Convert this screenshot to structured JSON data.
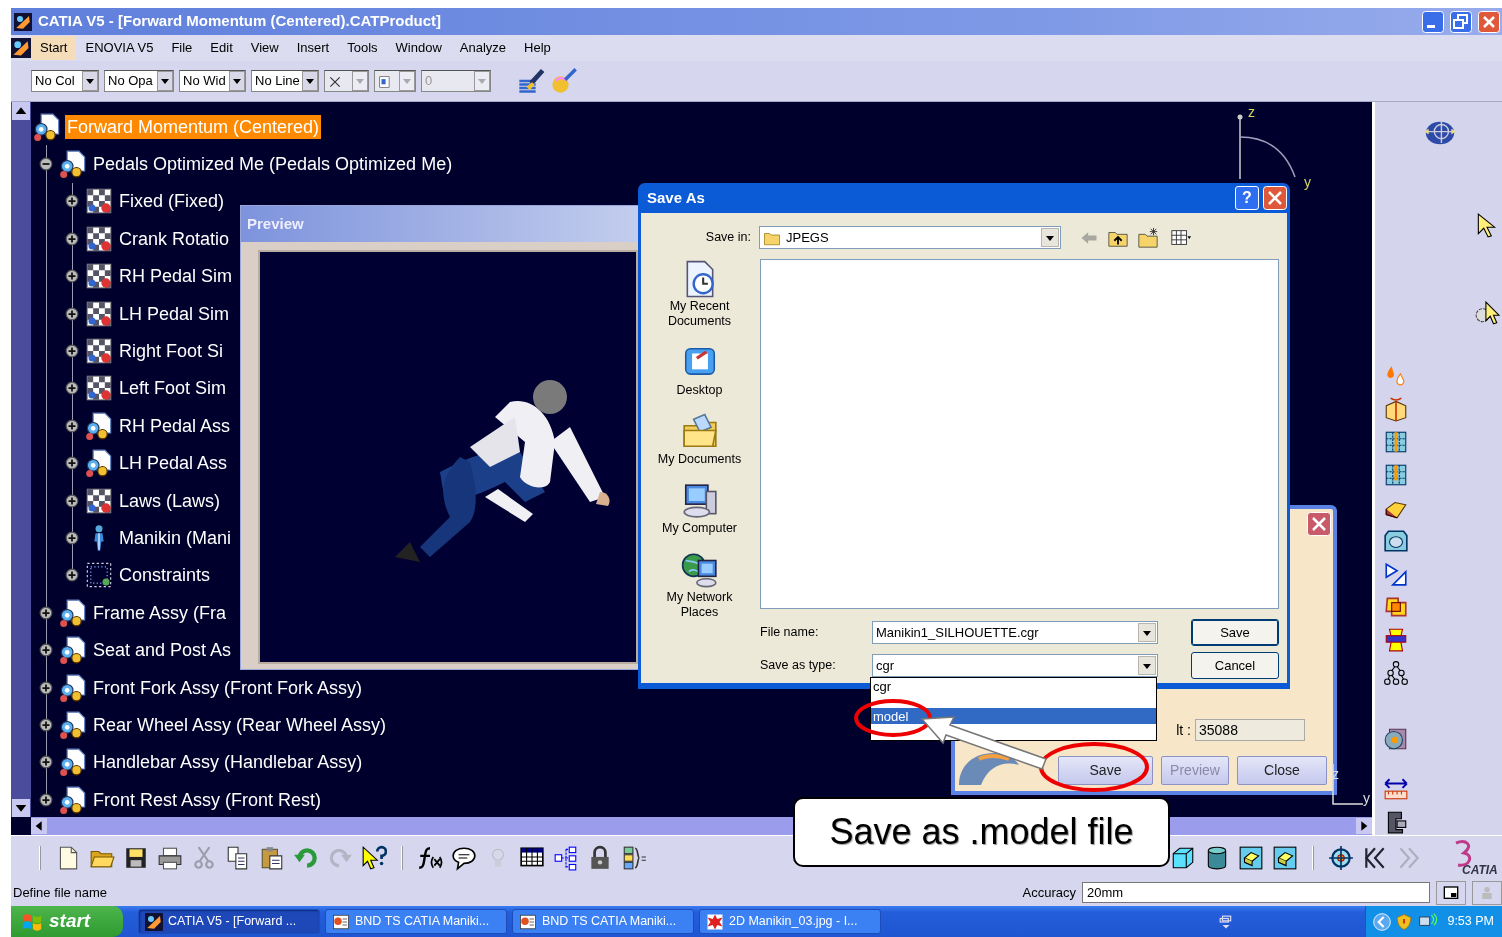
{
  "window": {
    "title": "CATIA V5 - [Forward Momentum (Centered).CATProduct]"
  },
  "menu": [
    {
      "label": "Start",
      "selected": true
    },
    {
      "label": "ENOVIA V5",
      "selected": false
    },
    {
      "label": "File",
      "selected": false
    },
    {
      "label": "Edit",
      "selected": false
    },
    {
      "label": "View",
      "selected": false
    },
    {
      "label": "Insert",
      "selected": false
    },
    {
      "label": "Tools",
      "selected": false
    },
    {
      "label": "Window",
      "selected": false
    },
    {
      "label": "Analyze",
      "selected": false
    },
    {
      "label": "Help",
      "selected": false
    }
  ],
  "graphic_toolbar": [
    {
      "kind": "text",
      "value": "No Col",
      "disabled": false
    },
    {
      "kind": "text",
      "value": "No Opa",
      "disabled": false
    },
    {
      "kind": "text",
      "value": "No Wid",
      "disabled": false
    },
    {
      "kind": "text",
      "value": "No Line",
      "disabled": false
    },
    {
      "kind": "linetype",
      "disabled": true
    },
    {
      "kind": "layer",
      "disabled": true
    },
    {
      "kind": "text",
      "value": "0",
      "disabled": true
    }
  ],
  "tree": {
    "label": "Forward Momentum (Centered)",
    "kind": "product",
    "selected": true,
    "children": [
      {
        "label": "Pedals Optimized Me (Pedals Optimized Me)",
        "kind": "product",
        "selected": false,
        "expanded": true,
        "children": [
          {
            "label": "Fixed (Fixed)",
            "kind": "mechanism",
            "selected": false,
            "expanded": false
          },
          {
            "label": "Crank Rotatio",
            "kind": "mechanism",
            "selected": false,
            "expanded": false
          },
          {
            "label": "RH Pedal Sim",
            "kind": "mechanism",
            "selected": false,
            "expanded": false
          },
          {
            "label": "LH Pedal Sim",
            "kind": "mechanism",
            "selected": false,
            "expanded": false
          },
          {
            "label": "Right Foot Si",
            "kind": "mechanism",
            "selected": false,
            "expanded": false
          },
          {
            "label": "Left Foot Sim",
            "kind": "mechanism",
            "selected": false,
            "expanded": false
          },
          {
            "label": "RH Pedal Ass",
            "kind": "product",
            "selected": false,
            "expanded": false
          },
          {
            "label": "LH Pedal Ass",
            "kind": "product",
            "selected": false,
            "expanded": false
          },
          {
            "label": "Laws (Laws)",
            "kind": "mechanism",
            "selected": false,
            "expanded": false
          },
          {
            "label": "Manikin (Mani",
            "kind": "manikin",
            "selected": false,
            "expanded": false
          },
          {
            "label": "Constraints",
            "kind": "constraints",
            "selected": false,
            "expanded": false
          }
        ]
      },
      {
        "label": "Frame Assy (Fra",
        "kind": "product",
        "selected": false,
        "expanded": false
      },
      {
        "label": "Seat and Post As",
        "kind": "product",
        "selected": false,
        "expanded": false
      },
      {
        "label": "Front Fork Assy (Front Fork Assy)",
        "kind": "product",
        "selected": false,
        "expanded": false
      },
      {
        "label": "Rear Wheel Assy (Rear Wheel Assy)",
        "kind": "product",
        "selected": false,
        "expanded": false
      },
      {
        "label": "Handlebar Assy (Handlebar Assy)",
        "kind": "product",
        "selected": false,
        "expanded": false
      },
      {
        "label": "Front Rest Assy (Front Rest)",
        "kind": "product",
        "selected": false,
        "expanded": false
      }
    ]
  },
  "preview_window": {
    "title": "Preview"
  },
  "compass": {
    "z_label": "z",
    "y_label": "y"
  },
  "axis": {
    "z_label": "z",
    "y_label": "y"
  },
  "save_as_dialog": {
    "title": "Save As",
    "help_button": "?",
    "save_in_label": "Save in:",
    "save_in_value": "JPEGS",
    "places": [
      {
        "label": "My Recent Documents",
        "kind": "recent"
      },
      {
        "label": "Desktop",
        "kind": "desktop"
      },
      {
        "label": "My Documents",
        "kind": "documents"
      },
      {
        "label": "My Computer",
        "kind": "computer"
      },
      {
        "label": "My Network Places",
        "kind": "network"
      }
    ],
    "file_name_label": "File name:",
    "file_name": "Manikin1_SILHOUETTE.cgr",
    "type_label": "Save as type:",
    "type_value": "cgr",
    "buttons": [
      "Save",
      "Cancel"
    ],
    "type_options": [
      {
        "label": "cgr",
        "selected": false
      },
      {
        "label": "model",
        "selected": true
      }
    ]
  },
  "back_panel": {
    "field_label": "lt :",
    "field_value": "35088",
    "buttons": [
      {
        "label": "Save",
        "disabled": false
      },
      {
        "label": "Preview",
        "disabled": true
      },
      {
        "label": "Close",
        "disabled": false
      }
    ]
  },
  "callout": {
    "text": "Save as .model file"
  },
  "standard_toolbar": [
    {
      "kind": "new",
      "disabled": false
    },
    {
      "kind": "open",
      "disabled": false
    },
    {
      "kind": "save",
      "disabled": false
    },
    {
      "kind": "print",
      "disabled": false
    },
    {
      "kind": "cut",
      "disabled": true
    },
    {
      "kind": "copy",
      "disabled": false
    },
    {
      "kind": "paste",
      "disabled": false
    },
    {
      "kind": "undo",
      "disabled": false
    },
    {
      "kind": "redo",
      "disabled": true
    },
    {
      "kind": "whatsthis",
      "disabled": false
    },
    {
      "kind": "separator"
    },
    {
      "kind": "formula",
      "disabled": false
    },
    {
      "kind": "comment",
      "disabled": false
    },
    {
      "kind": "bulb",
      "disabled": true
    },
    {
      "kind": "table",
      "disabled": false
    },
    {
      "kind": "tree",
      "disabled": false
    },
    {
      "kind": "lock",
      "disabled": false
    },
    {
      "kind": "stack",
      "disabled": false
    }
  ],
  "view_toolbar": [
    {
      "kind": "cube",
      "disabled": false
    },
    {
      "kind": "cylinder",
      "disabled": false
    },
    {
      "kind": "shaded",
      "disabled": false
    },
    {
      "kind": "shaded",
      "disabled": false
    },
    {
      "kind": "separator"
    },
    {
      "kind": "target",
      "disabled": false
    },
    {
      "kind": "rewind",
      "disabled": false
    },
    {
      "kind": "forward",
      "disabled": true
    }
  ],
  "logo": "CATIA",
  "status_bar": {
    "message": "Define file name",
    "accuracy_label": "Accuracy",
    "accuracy_value": "20mm"
  },
  "taskbar": {
    "start": "start",
    "tasks": [
      {
        "label": "CATIA V5 - [Forward ...",
        "kind": "catia",
        "selected": true
      },
      {
        "label": "BND TS CATIA Maniki...",
        "kind": "slides",
        "selected": false
      },
      {
        "label": "BND TS CATIA Maniki...",
        "kind": "slides",
        "selected": false
      },
      {
        "label": "2D Manikin_03.jpg - I...",
        "kind": "image",
        "selected": false
      }
    ],
    "clock": "9:53 PM"
  }
}
